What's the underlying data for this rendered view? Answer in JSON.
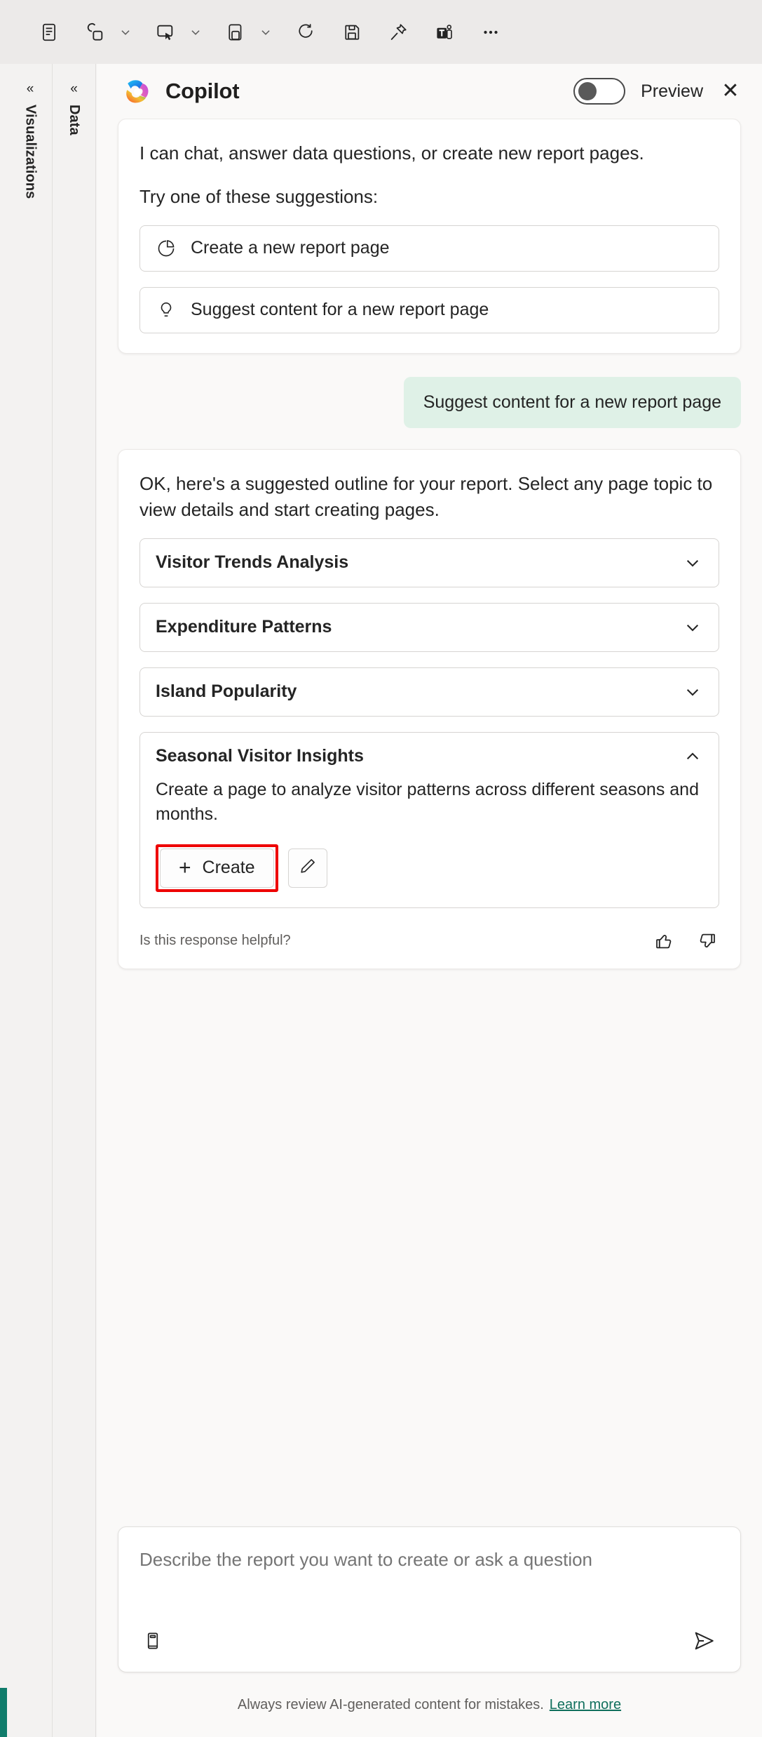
{
  "toolbar": {
    "items": [
      {
        "name": "page-view-icon",
        "label": "Page view",
        "caret": false
      },
      {
        "name": "mobile-layout-icon",
        "label": "Mobile layout",
        "caret": true
      },
      {
        "name": "filters-pane-icon",
        "label": "Filters",
        "caret": true
      },
      {
        "name": "bookmarks-icon",
        "label": "Bookmarks",
        "caret": true
      },
      {
        "name": "refresh-icon",
        "label": "Refresh",
        "caret": false
      },
      {
        "name": "save-icon",
        "label": "Save",
        "caret": false
      },
      {
        "name": "pin-icon",
        "label": "Pin to dashboard",
        "caret": false
      },
      {
        "name": "teams-share-icon",
        "label": "Share to Teams",
        "caret": false
      },
      {
        "name": "more-options-icon",
        "label": "More options",
        "caret": false
      }
    ]
  },
  "panes": {
    "visualizations": {
      "title": "Visualizations",
      "collapse_glyph": "«"
    },
    "data": {
      "title": "Data",
      "collapse_glyph": "«"
    }
  },
  "copilot": {
    "title": "Copilot",
    "preview_label": "Preview",
    "preview_on": false,
    "close_label": "✕",
    "intro": {
      "line1": "I can chat, answer data questions, or create new report pages.",
      "line2": "Try one of these suggestions:",
      "suggestions": [
        {
          "icon": "pie-chart-icon",
          "label": "Create a new report page"
        },
        {
          "icon": "lightbulb-icon",
          "label": "Suggest content for a new report page"
        }
      ]
    },
    "user_message": "Suggest content for a new report page",
    "response": {
      "text": "OK, here's a suggested outline for your report. Select any page topic to view details and start creating pages.",
      "topics": [
        {
          "title": "Visitor Trends Analysis",
          "expanded": false,
          "description": ""
        },
        {
          "title": "Expenditure Patterns",
          "expanded": false,
          "description": ""
        },
        {
          "title": "Island Popularity",
          "expanded": false,
          "description": ""
        },
        {
          "title": "Seasonal Visitor Insights",
          "expanded": true,
          "description": "Create a page to analyze visitor patterns across different seasons and months.",
          "create_label": "Create",
          "create_plus": "+",
          "edit_label": "Edit"
        }
      ],
      "feedback_question": "Is this response helpful?",
      "thumbs_up_label": "Like",
      "thumbs_down_label": "Dislike"
    },
    "composer": {
      "placeholder": "Describe the report you want to create or ask a question",
      "value": "",
      "prompt_guide_label": "Prompt guide",
      "send_label": "Send"
    },
    "footer": {
      "disclaimer": "Always review AI-generated content for mistakes.",
      "link": "Learn more"
    }
  },
  "colors": {
    "accent_green": "#107c6b",
    "user_bubble": "#dff1e7",
    "highlight_red": "#ee0000",
    "toolbar_bg": "#eceae9",
    "panel_bg": "#faf9f8"
  }
}
